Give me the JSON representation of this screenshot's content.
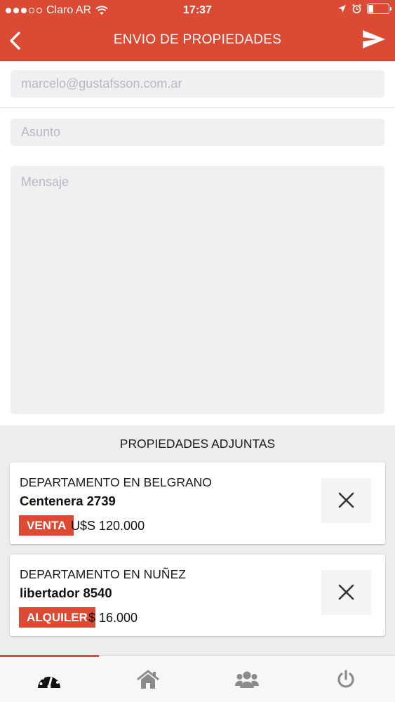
{
  "status_bar": {
    "carrier": "Claro AR",
    "time": "17:37",
    "signal_bars_filled": 3,
    "signal_bars_total": 5
  },
  "header": {
    "title": "ENVIO DE PROPIEDADES",
    "back_icon": "chevron-left-icon",
    "send_icon": "paper-plane-icon"
  },
  "form": {
    "email_value": "marcelo@gustafsson.com.ar",
    "subject_placeholder": "Asunto",
    "message_placeholder": "Mensaje"
  },
  "attachments": {
    "heading": "PROPIEDADES ADJUNTAS",
    "items": [
      {
        "type": "DEPARTAMENTO EN BELGRANO",
        "address": "Centenera 2739",
        "operation": "VENTA",
        "price": "U$S 120.000"
      },
      {
        "type": "DEPARTAMENTO EN NUÑEZ",
        "address": "libertador 8540",
        "operation": "ALQUILER",
        "price": "$ 16.000"
      }
    ]
  },
  "tabbar": {
    "tabs": [
      {
        "icon": "dashboard-icon",
        "active": true
      },
      {
        "icon": "home-icon",
        "active": false
      },
      {
        "icon": "users-icon",
        "active": false
      },
      {
        "icon": "power-icon",
        "active": false
      }
    ]
  },
  "colors": {
    "accent": "#dc4a33",
    "field_bg": "#f0f0f2",
    "section_bg": "#ededee"
  }
}
